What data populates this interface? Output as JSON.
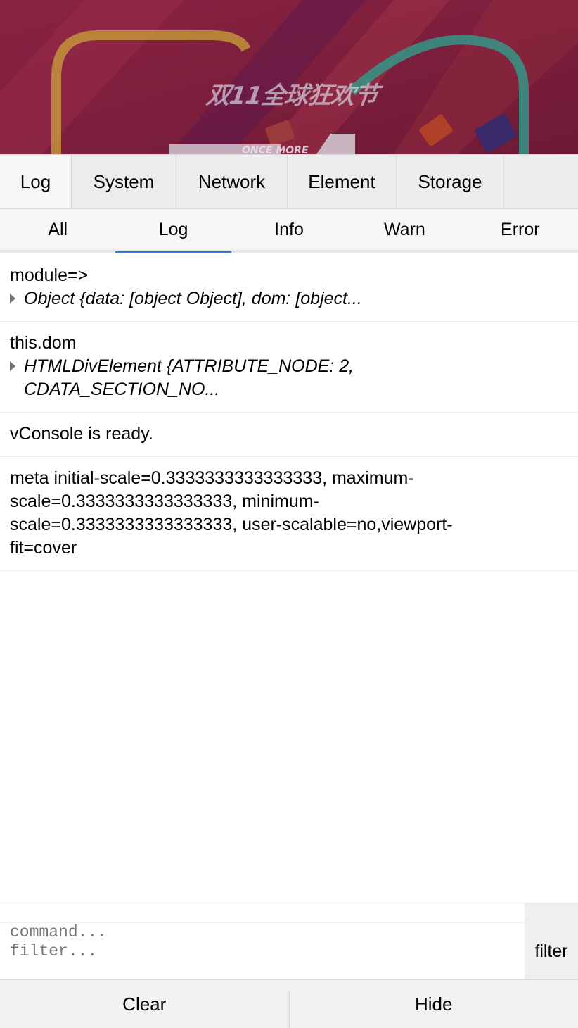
{
  "banner": {
    "title": "双11全球狂欢节",
    "subtitle": "ONCE MORE"
  },
  "tabs": [
    {
      "label": "Log"
    },
    {
      "label": "System"
    },
    {
      "label": "Network"
    },
    {
      "label": "Element"
    },
    {
      "label": "Storage"
    }
  ],
  "subtabs": [
    {
      "label": "All"
    },
    {
      "label": "Log"
    },
    {
      "label": "Info"
    },
    {
      "label": "Warn"
    },
    {
      "label": "Error"
    }
  ],
  "logs": [
    {
      "text": "module=>",
      "object": "Object {data: [object Object], dom: [object..."
    },
    {
      "text": "this.dom",
      "object": "HTMLDivElement {ATTRIBUTE_NODE: 2, CDATA_SECTION_NO..."
    },
    {
      "text": "vConsole is ready."
    },
    {
      "text": "meta initial-scale=0.3333333333333333, maximum-scale=0.3333333333333333, minimum-scale=0.3333333333333333, user-scalable=no,viewport-fit=cover"
    }
  ],
  "command": {
    "placeholder": "command...",
    "filter_placeholder": "filter...",
    "filter_label": "filter"
  },
  "toolbar": {
    "clear_label": "Clear",
    "hide_label": "Hide"
  },
  "colors": {
    "accent": "#2b7bd8",
    "banner_bg": "#7a1f3a"
  }
}
